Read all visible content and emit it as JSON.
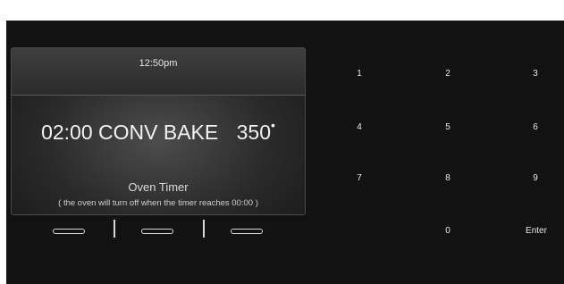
{
  "display": {
    "clock": "12:50pm",
    "cook_time": "02:00",
    "mode": "CONV BAKE",
    "temperature": "350",
    "degree_symbol": "•",
    "timer_title": "Oven Timer",
    "timer_note": "( the oven will turn off when the timer reaches 00:00 )"
  },
  "keypad": {
    "k1": "1",
    "k2": "2",
    "k3": "3",
    "k4": "4",
    "k5": "5",
    "k6": "6",
    "k7": "7",
    "k8": "8",
    "k9": "9",
    "k0": "0",
    "enter": "Enter"
  },
  "colors": {
    "panel_background": "#121212",
    "text": "#e8e8e8"
  }
}
